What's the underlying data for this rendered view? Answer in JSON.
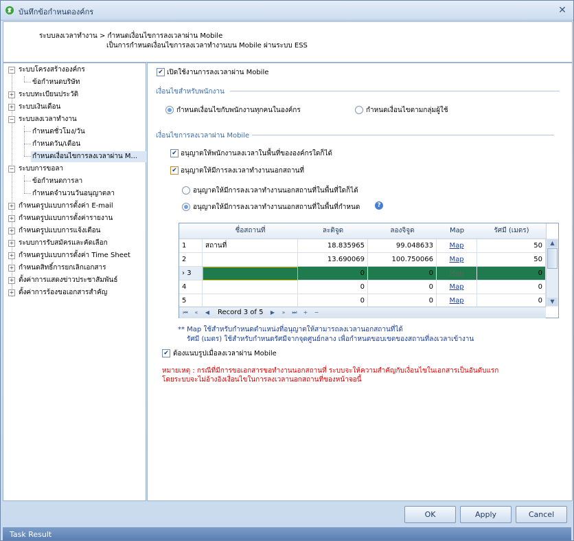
{
  "window": {
    "title": "บันทึกข้อกำหนดองค์กร"
  },
  "header": {
    "breadcrumb": "ระบบลงเวลาทำงาน > กำหนดเงื่อนไขการลงเวลาผ่าน Mobile",
    "description": "เป็นการกำหนดเงื่อนไขการลงเวลาทำงานบน Mobile ผ่านระบบ ESS"
  },
  "tree": {
    "items": [
      "ระบบโครงสร้างองค์กร",
      "ข้อกำหนดบริษัท",
      "ระบบทะเบียนประวัติ",
      "ระบบเงินเดือน",
      "ระบบลงเวลาทำงาน",
      "กำหนดชั่วโมง/วัน",
      "กำหนดวัน/เดือน",
      "กำหนดเงื่อนไขการลงเวลาผ่าน M...",
      "ระบบการขอลา",
      "ข้อกำหนดการลา",
      "กำหนดจำนวนวันอนุญาตลา",
      "กำหนดรูปแบบการตั้งค่า E-mail",
      "กำหนดรูปแบบการตั้งค่ารายงาน",
      "กำหนดรูปแบบการแจ้งเตือน",
      "ระบบการรับสมัครและคัดเลือก",
      "กำหนดรูปแบบการตั้งค่า Time Sheet",
      "กำหนดสิทธิ์การยกเลิกเอกสาร",
      "ตั้งค่าการแสดงข่าวประชาสัมพันธ์",
      "ตั้งค่าการร้องขอเอกสารสำคัญ"
    ]
  },
  "panel": {
    "enable_mobile": "เปิดใช้งานการลงเวลาผ่าน Mobile",
    "section_employee": "เงื่อนไขสำหรับพนักงาน",
    "radio_all": "กำหนดเงื่อนไขกับพนักงานทุกคนในองค์กร",
    "radio_group": "กำหนดเงื่อนไขตามกลุ่มผู้ใช้",
    "section_mobile": "เงื่อนไขการลงเวลาผ่าน Mobile",
    "allow_in_area": "อนุญาตให้พนักงานลงเวลาในพื้นที่ขององค์กรใดก็ได้",
    "allow_outside": "อนุญาตให้มีการลงเวลาทำงานนอกสถานที่",
    "radio_any_area": "อนุญาตให้มีการลงเวลาทำงานนอกสถานที่ในพื้นที่ใดก็ได้",
    "radio_defined_area": "อนุญาตให้มีการลงเวลาทำงานนอกสถานที่ในพื้นที่กำหนด",
    "note1": "** Map ใช้สำหรับกำหนดตำแหน่งที่อนุญาตให้สามารถลงเวลานอกสถานที่ได้",
    "note2": "รัศมี (เมตร) ใช้สำหรับกำหนดรัศมีจากจุดศูนย์กลาง เพื่อกำหนดขอบเขตของสถานที่ลงเวลาเข้างาน",
    "require_photo": "ต้องแนบรูปเมื่อลงเวลาผ่าน Mobile",
    "remark1": "หมายเหตุ : กรณีที่มีการขอเอกสารขอทำงานนอกสถานที่ ระบบจะให้ความสำคัญกับเงื่อนไขในเอกสารเป็นอันดับแรก",
    "remark2": "โดยระบบจะไม่อ้างอิงเงื่อนไขในการลงเวลานอกสถานที่ของหน้าจอนี้"
  },
  "grid": {
    "columns": [
      "ชื่อสถานที่",
      "ละติจูด",
      "ลองจิจูด",
      "Map",
      "รัศมี (เมตร)"
    ],
    "rows": [
      {
        "no": "1",
        "name": "สถานที่",
        "lat": "18.835965",
        "lng": "99.048633",
        "map": "Map",
        "radius": "50"
      },
      {
        "no": "2",
        "name": "",
        "lat": "13.690069",
        "lng": "100.750066",
        "map": "Map",
        "radius": "50"
      },
      {
        "no": "3",
        "name": "",
        "lat": "0",
        "lng": "0",
        "map": "Map",
        "radius": "0"
      },
      {
        "no": "4",
        "name": "",
        "lat": "0",
        "lng": "0",
        "map": "Map",
        "radius": "0"
      },
      {
        "no": "5",
        "name": "",
        "lat": "0",
        "lng": "0",
        "map": "Map",
        "radius": "0"
      }
    ],
    "record_text": "Record 3 of 5"
  },
  "buttons": {
    "ok": "OK",
    "apply": "Apply",
    "cancel": "Cancel"
  },
  "status": {
    "text": "Task Result"
  }
}
